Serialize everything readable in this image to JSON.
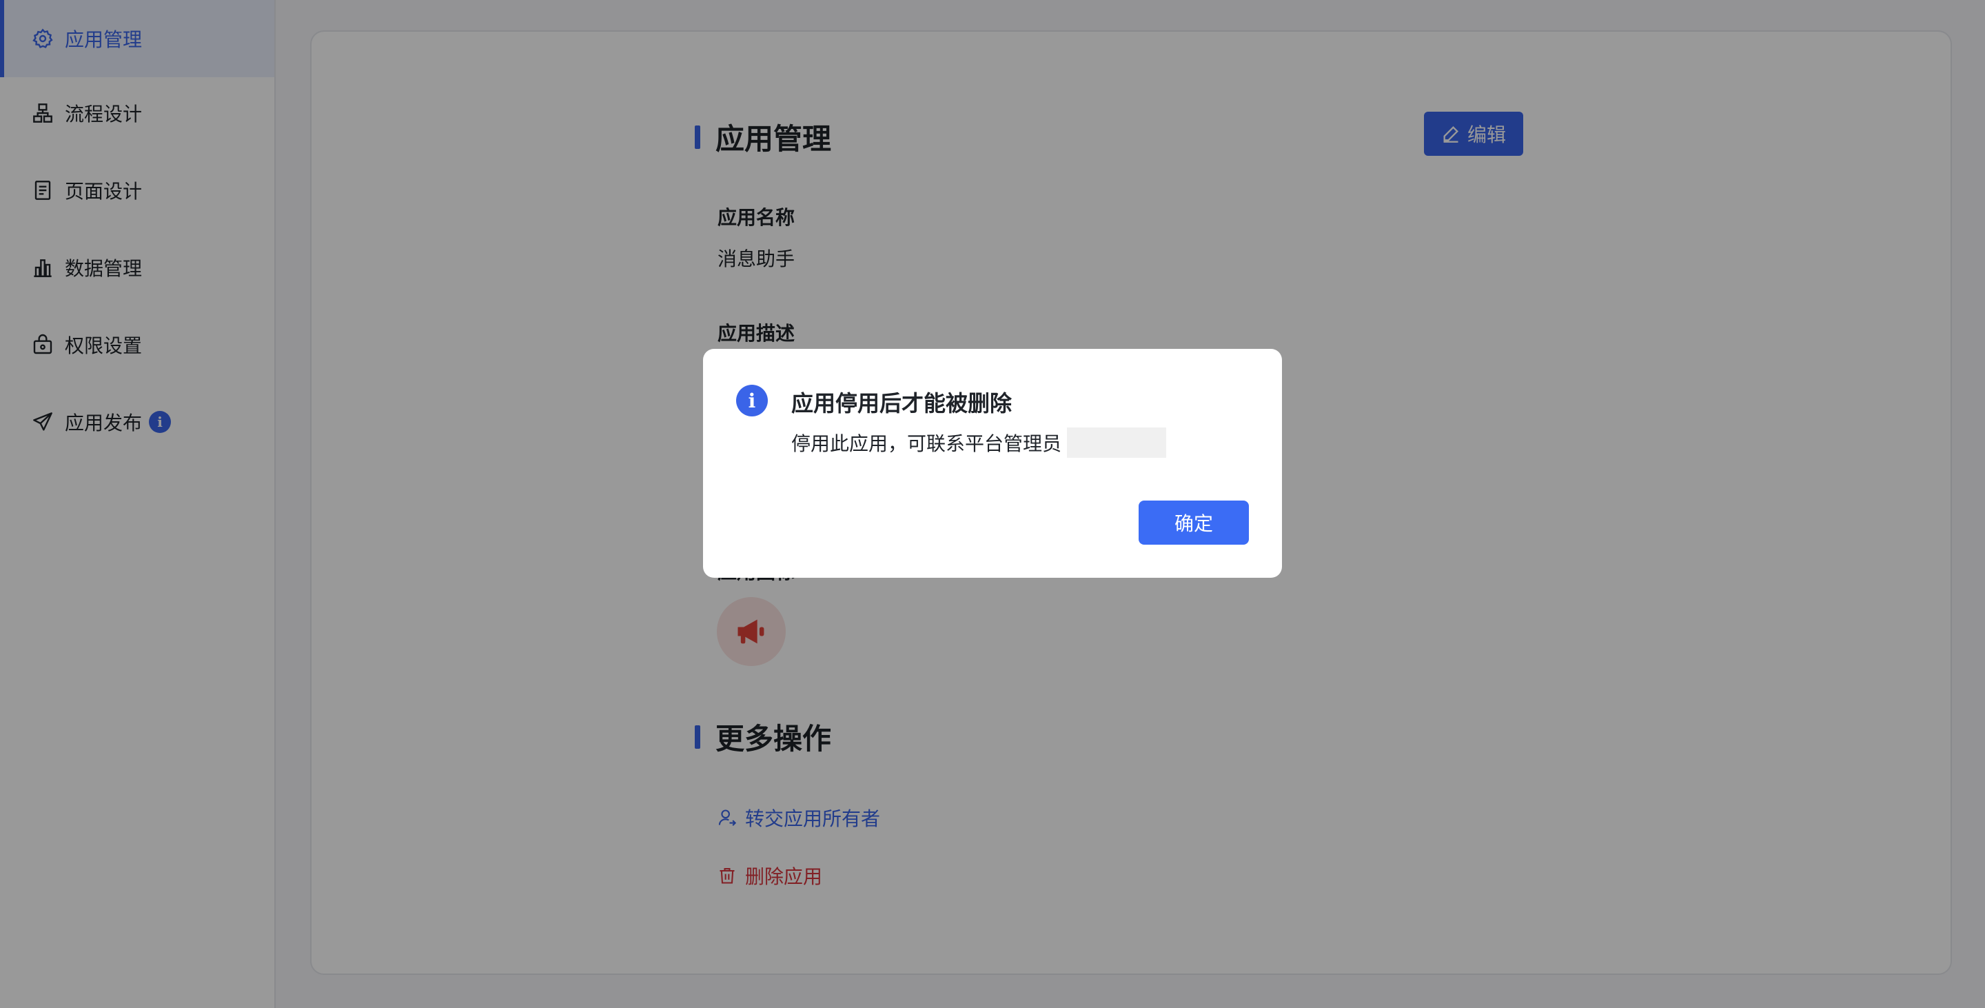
{
  "sidebar": {
    "items": [
      {
        "label": "应用管理",
        "icon": "gear-icon",
        "active": true
      },
      {
        "label": "流程设计",
        "icon": "flow-icon"
      },
      {
        "label": "页面设计",
        "icon": "document-icon"
      },
      {
        "label": "数据管理",
        "icon": "bar-chart-icon"
      },
      {
        "label": "权限设置",
        "icon": "lock-bag-icon"
      },
      {
        "label": "应用发布",
        "icon": "send-icon",
        "badge": "i"
      }
    ]
  },
  "main": {
    "section_title": "应用管理",
    "edit_label": "编辑",
    "name_label": "应用名称",
    "name_value": "消息助手",
    "desc_label": "应用描述",
    "icon_label": "应用图标",
    "more_title": "更多操作",
    "transfer_label": "转交应用所有者",
    "delete_label": "删除应用"
  },
  "dialog": {
    "icon": "i",
    "title": "应用停用后才能被删除",
    "body": "停用此应用，可联系平台管理员",
    "confirm_label": "确定"
  },
  "colors": {
    "accent": "#3a64e8",
    "danger": "#d9363e",
    "overlay": "rgba(0,0,0,0.40)"
  }
}
